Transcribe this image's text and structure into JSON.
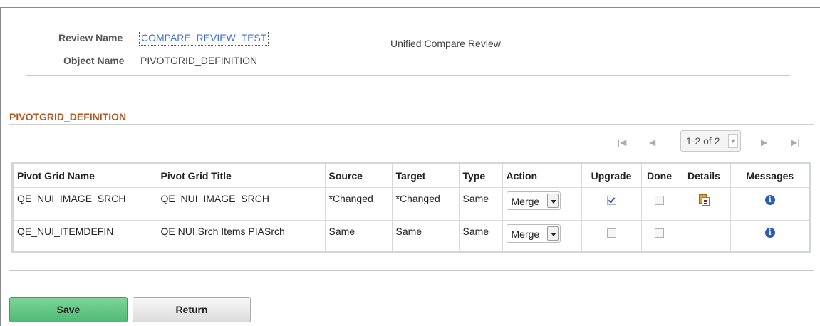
{
  "header": {
    "review_name_label": "Review Name",
    "review_name_value": "COMPARE_REVIEW_TEST",
    "object_name_label": "Object Name",
    "object_name_value": "PIVOTGRID_DEFINITION",
    "page_title": "Unified Compare Review"
  },
  "section": {
    "title": "PIVOTGRID_DEFINITION"
  },
  "pager": {
    "count": "1-2 of 2"
  },
  "grid": {
    "columns": [
      "Pivot Grid Name",
      "Pivot Grid Title",
      "Source",
      "Target",
      "Type",
      "Action",
      "Upgrade",
      "Done",
      "Details",
      "Messages"
    ],
    "rows": [
      {
        "name": "QE_NUI_IMAGE_SRCH",
        "title": "QE_NUI_IMAGE_SRCH",
        "source": "*Changed",
        "target": "*Changed",
        "type": "Same",
        "action": "Merge",
        "upgrade": true,
        "done": false,
        "details_icon": "details-icon",
        "messages_icon": "info-icon"
      },
      {
        "name": "QE_NUI_ITEMDEFIN",
        "title": "QE NUI Srch Items PIASrch",
        "source": "Same",
        "target": "Same",
        "type": "Same",
        "action": "Merge",
        "upgrade": false,
        "done": false,
        "details_icon": "",
        "messages_icon": "info-icon"
      }
    ]
  },
  "buttons": {
    "save": "Save",
    "return": "Return"
  },
  "colors": {
    "section_title": "#b0561f",
    "link": "#3c6ed0",
    "save_button": "#5cc27f",
    "info_icon": "#2a5bb5"
  }
}
